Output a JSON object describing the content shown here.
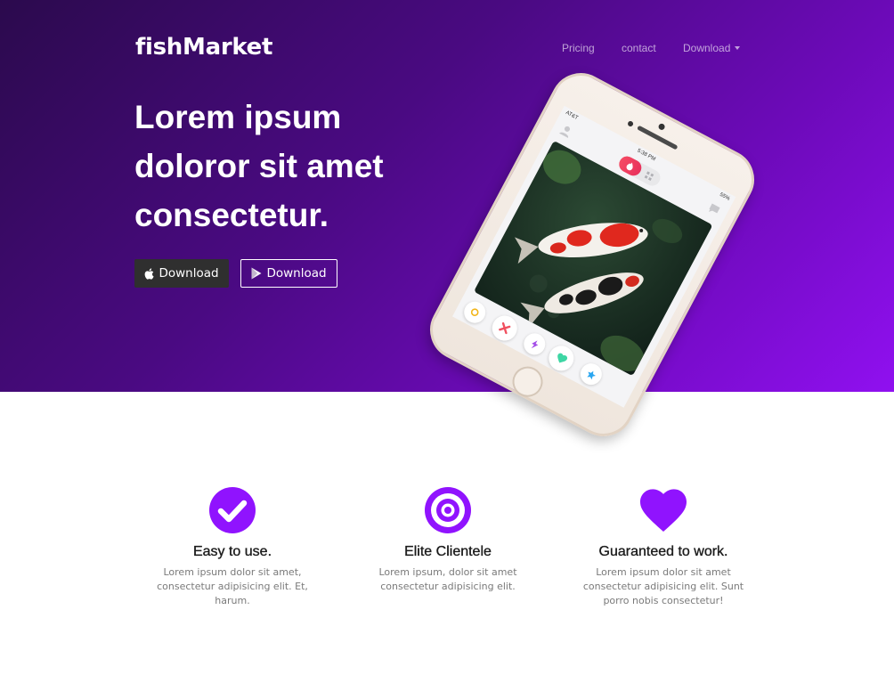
{
  "brand": {
    "name": "fishMarket"
  },
  "nav": {
    "items": [
      {
        "label": "Pricing"
      },
      {
        "label": "contact"
      },
      {
        "label": "Download",
        "dropdown": true
      }
    ]
  },
  "hero": {
    "headline": "Lorem ipsum doloror sit amet consectetur.",
    "buttons": [
      {
        "label": "Download",
        "icon": "apple-icon",
        "style": "dark"
      },
      {
        "label": "Download",
        "icon": "google-play-icon",
        "style": "outline"
      }
    ],
    "gradient": [
      "#2b0a4d",
      "#4a0a82",
      "#6c0ab8",
      "#9010f0"
    ]
  },
  "phone": {
    "status": {
      "carrier": "AT&T",
      "time": "5:38 PM",
      "battery": "55%"
    }
  },
  "features": [
    {
      "icon": "check-circle-icon",
      "title": "Easy to use.",
      "description": "Lorem ipsum dolor sit amet, consectetur adipisicing elit. Et, harum."
    },
    {
      "icon": "bullseye-icon",
      "title": "Elite Clientele",
      "description": "Lorem ipsum, dolor sit amet consectetur adipisicing elit."
    },
    {
      "icon": "heart-icon",
      "title": "Guaranteed to work.",
      "description": "Lorem ipsum dolor sit amet consectetur adipisicing elit. Sunt porro nobis consectetur!"
    }
  ],
  "colors": {
    "accent": "#9013fe",
    "title_text": "#1b1b1b",
    "body_text": "#7a7a7a",
    "apple_button_bg": "#2f2f2f"
  }
}
